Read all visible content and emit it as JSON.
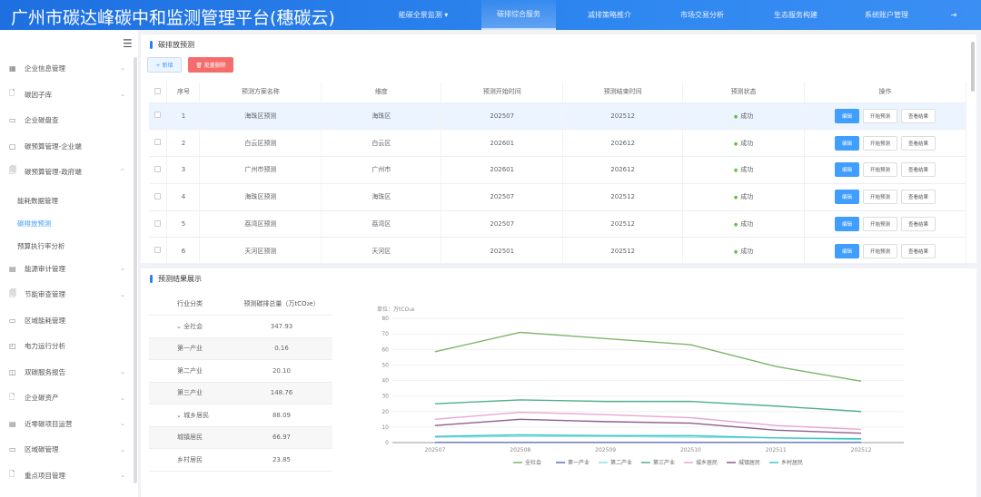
{
  "header": {
    "title": "广州市碳达峰碳中和监测管理平台(穗碳云)",
    "nav": [
      "能碳全景监测 ▾",
      "碳排综合服务",
      "减排策略推介",
      "市场交易分析",
      "生态服务构建",
      "系统账户管理"
    ],
    "logout": "⇥"
  },
  "sidebar": {
    "items": [
      {
        "icon": "▦",
        "label": "企业信息管理"
      },
      {
        "icon": "🗋",
        "label": "碳因子库"
      },
      {
        "icon": "▭",
        "label": "企业碳盘查"
      },
      {
        "icon": "▢",
        "label": "碳预算管理-企业端"
      },
      {
        "icon": "🗐",
        "label": "碳预算管理-政府端"
      }
    ],
    "subitems": [
      "能耗数据管理",
      "碳排放预测",
      "预算执行率分析"
    ],
    "items2": [
      {
        "icon": "▤",
        "label": "能源审计管理"
      },
      {
        "icon": "🗐",
        "label": "节能审查管理"
      },
      {
        "icon": "▭",
        "label": "区域能耗管理"
      },
      {
        "icon": "◰",
        "label": "电力运行分析"
      },
      {
        "icon": "◫",
        "label": "双碳服务报告"
      },
      {
        "icon": "🗋",
        "label": "企业碳资产"
      },
      {
        "icon": "▤",
        "label": "近零碳项目运营"
      },
      {
        "icon": "▭",
        "label": "区域碳管理"
      },
      {
        "icon": "🗋",
        "label": "重点项目管理"
      }
    ]
  },
  "forecast": {
    "title": "碳排放预测",
    "add": "+ 新增",
    "batch_delete": "🗑 批量删除",
    "columns": [
      "序号",
      "预测方案名称",
      "维度",
      "预测开始时间",
      "预测结束时间",
      "预测状态",
      "操作"
    ],
    "rows": [
      [
        "1",
        "海珠区预测",
        "海珠区",
        "202507",
        "202512",
        "成功"
      ],
      [
        "2",
        "白云区预测",
        "白云区",
        "202601",
        "202612",
        "成功"
      ],
      [
        "3",
        "广州市预测",
        "广州市",
        "202601",
        "202612",
        "成功"
      ],
      [
        "4",
        "海珠区预测",
        "海珠区",
        "202507",
        "202512",
        "成功"
      ],
      [
        "5",
        "荔湾区预测",
        "荔湾区",
        "202507",
        "202512",
        "成功"
      ],
      [
        "6",
        "天河区预测",
        "天河区",
        "202501",
        "202512",
        "成功"
      ]
    ],
    "actions": [
      "编辑",
      "开始预测",
      "查看结果"
    ]
  },
  "results": {
    "title": "预测结果展示",
    "columns": [
      "行业分类",
      "预测碳排总量（万tCO₂e）"
    ],
    "rows": [
      [
        "⌄ 全社会",
        "347.93"
      ],
      [
        "第一产业",
        "0.16"
      ],
      [
        "第二产业",
        "20.10"
      ],
      [
        "第三产业",
        "148.76"
      ],
      [
        "⌄ 城乡居民",
        "88.09"
      ],
      [
        "城镇居民",
        "66.97"
      ],
      [
        "乡村居民",
        "23.85"
      ]
    ]
  },
  "chart_data": {
    "type": "line",
    "unit_label": "单位：万tCO₂e",
    "x": [
      "202507",
      "202508",
      "202509",
      "202510",
      "202511",
      "202512"
    ],
    "ylim": [
      0,
      80
    ],
    "yticks": [
      0,
      10,
      20,
      30,
      40,
      50,
      60,
      70,
      80
    ],
    "legend": "bottom",
    "series": [
      {
        "name": "全社会",
        "color": "#7cb56a",
        "values": [
          58.5,
          71,
          67,
          63,
          49,
          39.5
        ]
      },
      {
        "name": "第一产业",
        "color": "#5b6fb5",
        "values": [
          0.1,
          0.1,
          0.1,
          0.1,
          0.1,
          0.1
        ]
      },
      {
        "name": "第二产业",
        "color": "#8fe0df",
        "values": [
          3.5,
          4,
          4,
          3.5,
          3,
          2
        ]
      },
      {
        "name": "第三产业",
        "color": "#4fae8e",
        "values": [
          25,
          27.5,
          26.5,
          26.5,
          23.5,
          20
        ]
      },
      {
        "name": "城乡居民",
        "color": "#e7a6d8",
        "values": [
          15,
          19.5,
          18,
          16,
          11,
          8.5
        ]
      },
      {
        "name": "城镇居民",
        "color": "#8e5c8f",
        "values": [
          11,
          15,
          13.5,
          12.5,
          8,
          6
        ]
      },
      {
        "name": "乡村居民",
        "color": "#3ec7c7",
        "values": [
          4,
          5,
          4.5,
          4.5,
          3,
          2.5
        ]
      }
    ]
  }
}
